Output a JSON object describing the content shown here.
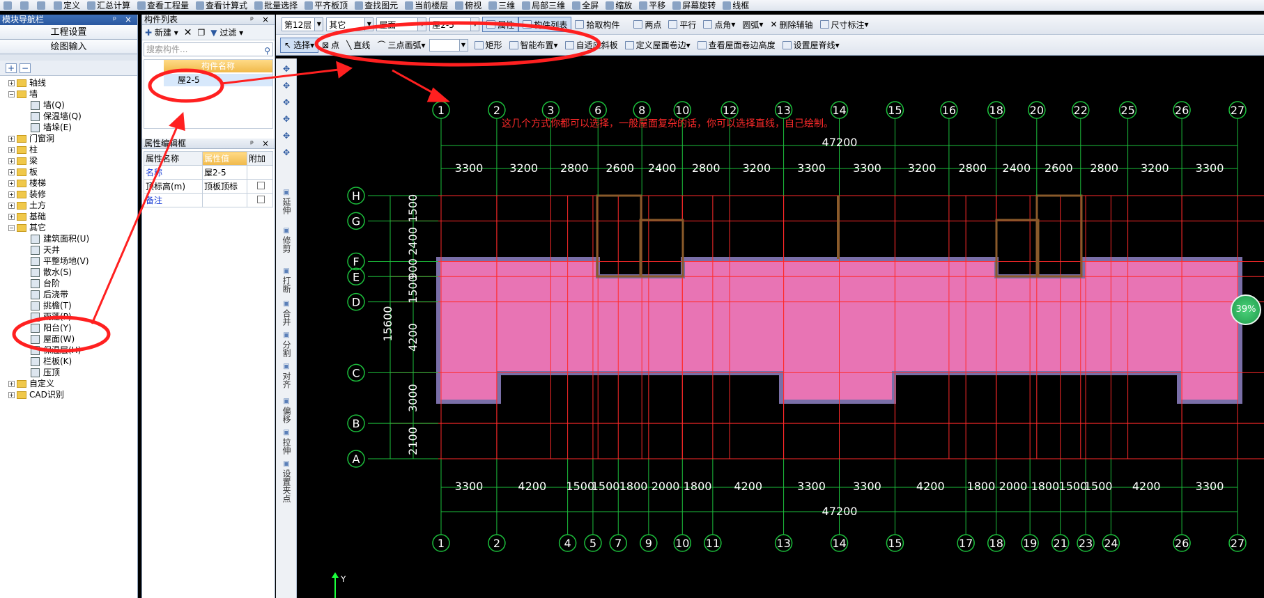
{
  "toolbar_top": {
    "items": [
      "定义",
      "汇总计算",
      "查看工程量",
      "查看计算式",
      "批量选择",
      "平齐板顶",
      "查找图元",
      "当前楼层",
      "俯视",
      "三维",
      "局部三维",
      "全屏",
      "缩放",
      "平移",
      "屏幕旋转",
      "线框"
    ]
  },
  "nav": {
    "title": "模块导航栏",
    "controls": "ᵖ ×",
    "btn_project": "工程设置",
    "btn_draw": "绘图输入",
    "tree": [
      {
        "label": "轴线",
        "level": 0,
        "exp": "+"
      },
      {
        "label": "墙",
        "level": 0,
        "exp": "−"
      },
      {
        "label": "墙(Q)",
        "level": 1
      },
      {
        "label": "保温墙(Q)",
        "level": 1
      },
      {
        "label": "墙垛(E)",
        "level": 1
      },
      {
        "label": "门窗洞",
        "level": 0,
        "exp": "+"
      },
      {
        "label": "柱",
        "level": 0,
        "exp": "+"
      },
      {
        "label": "梁",
        "level": 0,
        "exp": "+"
      },
      {
        "label": "板",
        "level": 0,
        "exp": "+"
      },
      {
        "label": "楼梯",
        "level": 0,
        "exp": "+"
      },
      {
        "label": "装修",
        "level": 0,
        "exp": "+"
      },
      {
        "label": "土方",
        "level": 0,
        "exp": "+"
      },
      {
        "label": "基础",
        "level": 0,
        "exp": "+"
      },
      {
        "label": "其它",
        "level": 0,
        "exp": "−"
      },
      {
        "label": "建筑面积(U)",
        "level": 1
      },
      {
        "label": "天井",
        "level": 1
      },
      {
        "label": "平整场地(V)",
        "level": 1
      },
      {
        "label": "散水(S)",
        "level": 1
      },
      {
        "label": "台阶",
        "level": 1
      },
      {
        "label": "后浇带",
        "level": 1
      },
      {
        "label": "挑檐(T)",
        "level": 1
      },
      {
        "label": "雨蓬(P)",
        "level": 1
      },
      {
        "label": "阳台(Y)",
        "level": 1
      },
      {
        "label": "屋面(W)",
        "level": 1
      },
      {
        "label": "保温层(H)",
        "level": 1
      },
      {
        "label": "栏板(K)",
        "level": 1
      },
      {
        "label": "压顶",
        "level": 1
      },
      {
        "label": "自定义",
        "level": 0,
        "exp": "+"
      },
      {
        "label": "CAD识别",
        "level": 0,
        "exp": "+"
      }
    ]
  },
  "comp": {
    "title": "构件列表",
    "new_label": "新建",
    "filter_label": "过滤",
    "search_placeholder": "搜索构件...",
    "col_name": "构件名称",
    "row_item": "屋2-5"
  },
  "props": {
    "title": "属性编辑框",
    "col_name": "属性名称",
    "col_value": "属性值",
    "col_extra": "附加",
    "rows": [
      {
        "name": "名称",
        "value": "屋2-5",
        "blue": true
      },
      {
        "name": "顶标高(m)",
        "value": "顶板顶标",
        "blue": false
      },
      {
        "name": "备注",
        "value": "",
        "blue": true
      }
    ]
  },
  "tb2": {
    "floor": "第12层",
    "category": "其它",
    "type": "屋面",
    "component": "屋2-5",
    "attr_btn": "属性",
    "list_btn": "构件列表",
    "pick_btn": "拾取构件",
    "two_points": "两点",
    "parallel": "平行",
    "point_angle": "点角",
    "arc": "圆弧",
    "del_aux": "删除辅轴",
    "dim": "尺寸标注"
  },
  "tb3": {
    "select": "选择",
    "point": "点",
    "line": "直线",
    "three_arc": "三点画弧",
    "rect": "矩形",
    "smart": "智能布置",
    "adapt_slope": "自适应斜板",
    "define_edge": "定义屋面卷边",
    "view_edge": "查看屋面卷边高度",
    "ridge": "设置屋脊线"
  },
  "vstrip": [
    "延伸",
    "修剪",
    "打断",
    "合并",
    "分割",
    "对齐",
    "偏移",
    "拉伸",
    "设置夹点"
  ],
  "annotation": "这几个方式你都可以选择，一般屋面复杂的话，你可以选择直线，自己绘制。",
  "zoom_badge": "39%",
  "chart_data": {
    "top_axes": [
      "1",
      "2",
      "3",
      "6",
      "8",
      "10",
      "12",
      "13",
      "14",
      "15",
      "16",
      "18",
      "20",
      "22",
      "25",
      "26",
      "27"
    ],
    "top_spacings": [
      "3300",
      "3200",
      "2800",
      "2600",
      "2400",
      "2800",
      "3200",
      "3300",
      "3300",
      "3200",
      "2800",
      "2400",
      "2600",
      "2800",
      "3200",
      "3300"
    ],
    "bottom_axes": [
      "1",
      "2",
      "4",
      "5",
      "7",
      "9",
      "10",
      "11",
      "13",
      "14",
      "15",
      "17",
      "18",
      "19",
      "21",
      "23",
      "24",
      "26",
      "27"
    ],
    "bottom_spacings": [
      "3300",
      "4200",
      "1500",
      "1500",
      "1800",
      "2000",
      "1800",
      "4200",
      "3300",
      "3300",
      "4200",
      "1800",
      "2000",
      "1800",
      "1500",
      "1500",
      "4200",
      "3300"
    ],
    "total_width": "47200",
    "row_axes": [
      "H",
      "G",
      "F",
      "E",
      "D",
      "C",
      "B",
      "A"
    ],
    "row_spacings": [
      "1500",
      "2400",
      "900",
      "1500",
      "4200",
      "3000",
      "2100"
    ],
    "total_depth": "15600",
    "colors": {
      "roof": "#e874b4",
      "grid": "#ff2a2a",
      "dim": "#1cbf3c",
      "wall": "#7a6fa8",
      "annot": "#ff2a2a"
    }
  }
}
